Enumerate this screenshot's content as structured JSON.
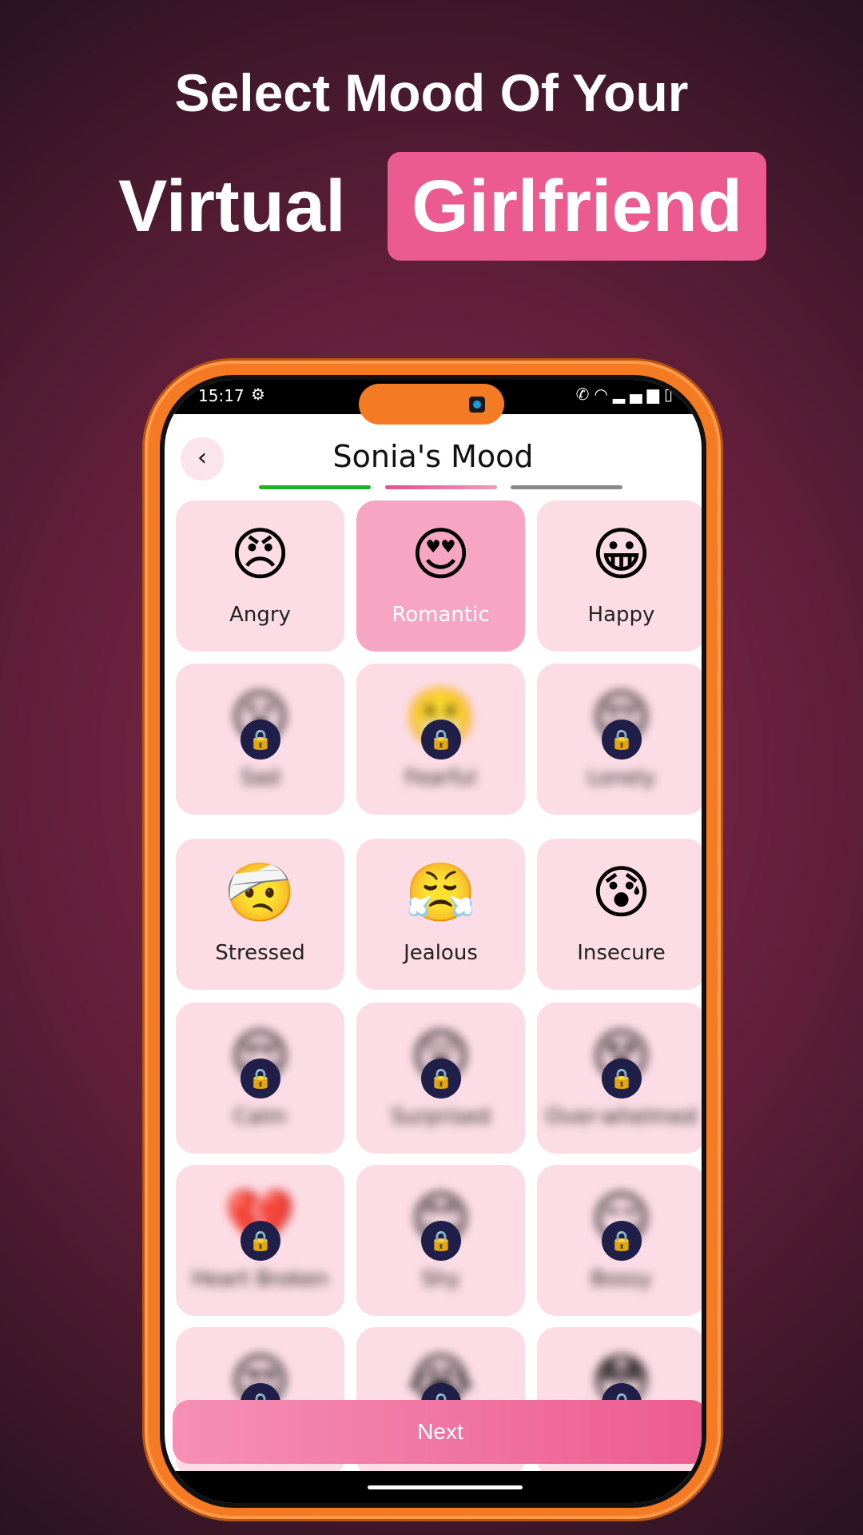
{
  "headline": {
    "line1": "Select Mood Of Your",
    "line2": "Virtual",
    "highlight": "Girlfriend"
  },
  "status_bar": {
    "time": "15:17",
    "icons": [
      "settings-icon",
      "wifi-call-icon",
      "wifi-icon",
      "signal-icon",
      "battery-charging-icon"
    ]
  },
  "header": {
    "title": "Sonia's Mood",
    "back_icon": "chevron-left-icon"
  },
  "progress": {
    "steps": 3,
    "current": 2,
    "colors": [
      "#1fb226",
      "#ec5b8f",
      "#888888"
    ]
  },
  "moods": [
    {
      "label": "Angry",
      "emoji": "😠",
      "locked": false,
      "selected": false
    },
    {
      "label": "Romantic",
      "emoji": "😍",
      "locked": false,
      "selected": true
    },
    {
      "label": "Happy",
      "emoji": "😀",
      "locked": false,
      "selected": false
    },
    {
      "label": "Sad",
      "emoji": "😮",
      "locked": true
    },
    {
      "label": "Fearful",
      "emoji": "😬",
      "locked": true
    },
    {
      "label": "Lonely",
      "emoji": "😔",
      "locked": true
    },
    {
      "label": "Stressed",
      "emoji": "🤕",
      "locked": false
    },
    {
      "label": "Jealous",
      "emoji": "😤",
      "locked": false
    },
    {
      "label": "Insecure",
      "emoji": "😰",
      "locked": false
    },
    {
      "label": "Calm",
      "emoji": "😌",
      "locked": true
    },
    {
      "label": "Surprised",
      "emoji": "😲",
      "locked": true
    },
    {
      "label": "Over-whelmed",
      "emoji": "😵",
      "locked": true
    },
    {
      "label": "Heart Broken",
      "emoji": "💔",
      "locked": true
    },
    {
      "label": "Shy",
      "emoji": "😊",
      "locked": true
    },
    {
      "label": "Bossy",
      "emoji": "😏",
      "locked": true
    },
    {
      "label": "",
      "emoji": "😒",
      "locked": true
    },
    {
      "label": "",
      "emoji": "😭",
      "locked": true
    },
    {
      "label": "",
      "emoji": "😳",
      "locked": true
    }
  ],
  "lock_icon": "🔒",
  "next_label": "Next",
  "colors": {
    "accent": "#ec5b8f",
    "selected_card": "#f6a6c3",
    "card": "#fcdde6",
    "frame": "#f57a24"
  }
}
